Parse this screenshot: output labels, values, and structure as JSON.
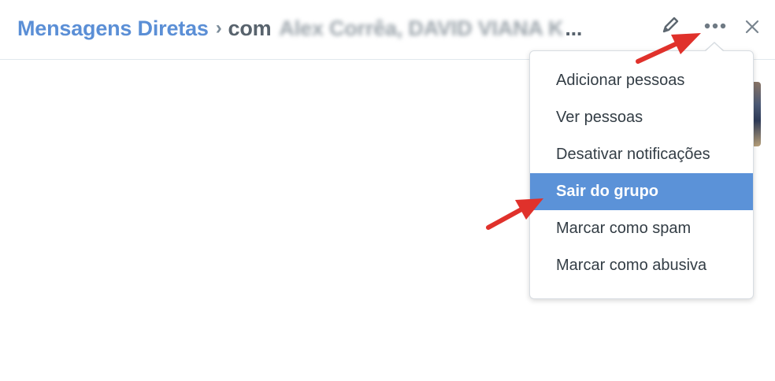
{
  "header": {
    "breadcrumb_root": "Mensagens Diretas",
    "breadcrumb_separator": "›",
    "breadcrumb_prefix": "com",
    "participants": "Alex Corrêa, DAVID VIANA K",
    "participants_truncation": "..."
  },
  "icons": {
    "edit": "pencil-icon",
    "more": "more-options-icon",
    "close": "close-icon"
  },
  "menu": {
    "items": [
      {
        "label": "Adicionar pessoas",
        "active": false
      },
      {
        "label": "Ver pessoas",
        "active": false
      },
      {
        "label": "Desativar notificações",
        "active": false
      },
      {
        "label": "Sair do grupo",
        "active": true
      },
      {
        "label": "Marcar como spam",
        "active": false
      },
      {
        "label": "Marcar como abusiva",
        "active": false
      }
    ]
  },
  "colors": {
    "link": "#5b8fd6",
    "highlight": "#5b92d8",
    "annotation_arrow": "#e0312b"
  }
}
